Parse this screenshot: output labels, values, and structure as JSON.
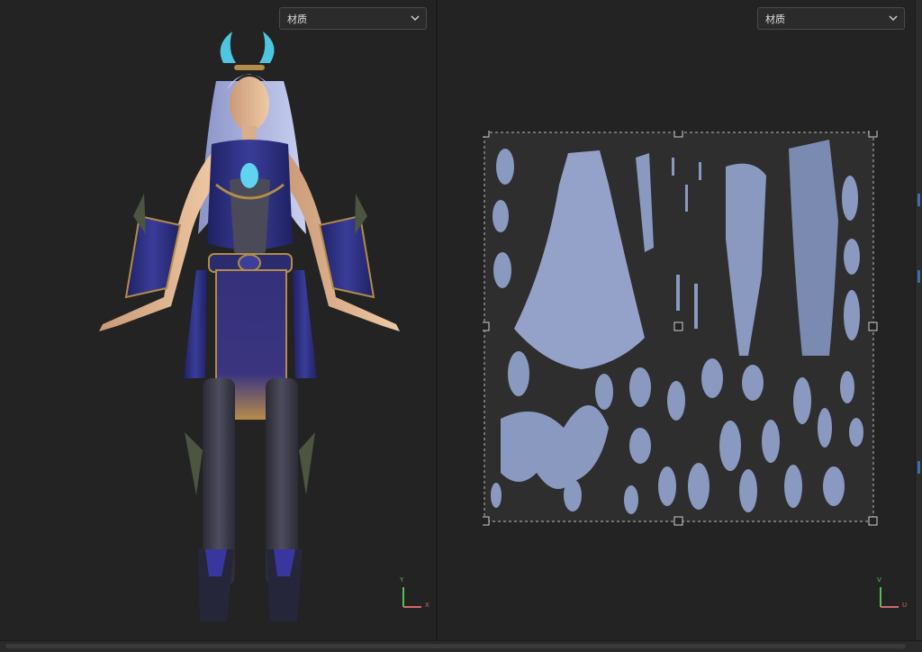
{
  "left_viewport": {
    "dropdown": {
      "selected": "材质"
    },
    "axis": {
      "up": "Y",
      "side": "X"
    }
  },
  "right_viewport": {
    "dropdown": {
      "selected": "材质"
    },
    "axis": {
      "up": "V",
      "side": "U"
    }
  },
  "colors": {
    "background": "#232323",
    "dropdown_bg": "#2b2b2b",
    "uv_island": "#8f9fc8",
    "armor_purple": "#2d2f78",
    "accent_blue": "#3b6fb0"
  },
  "icons": [
    "chevron-down-icon",
    "axis-gizmo-icon",
    "selection-handle-icon"
  ]
}
